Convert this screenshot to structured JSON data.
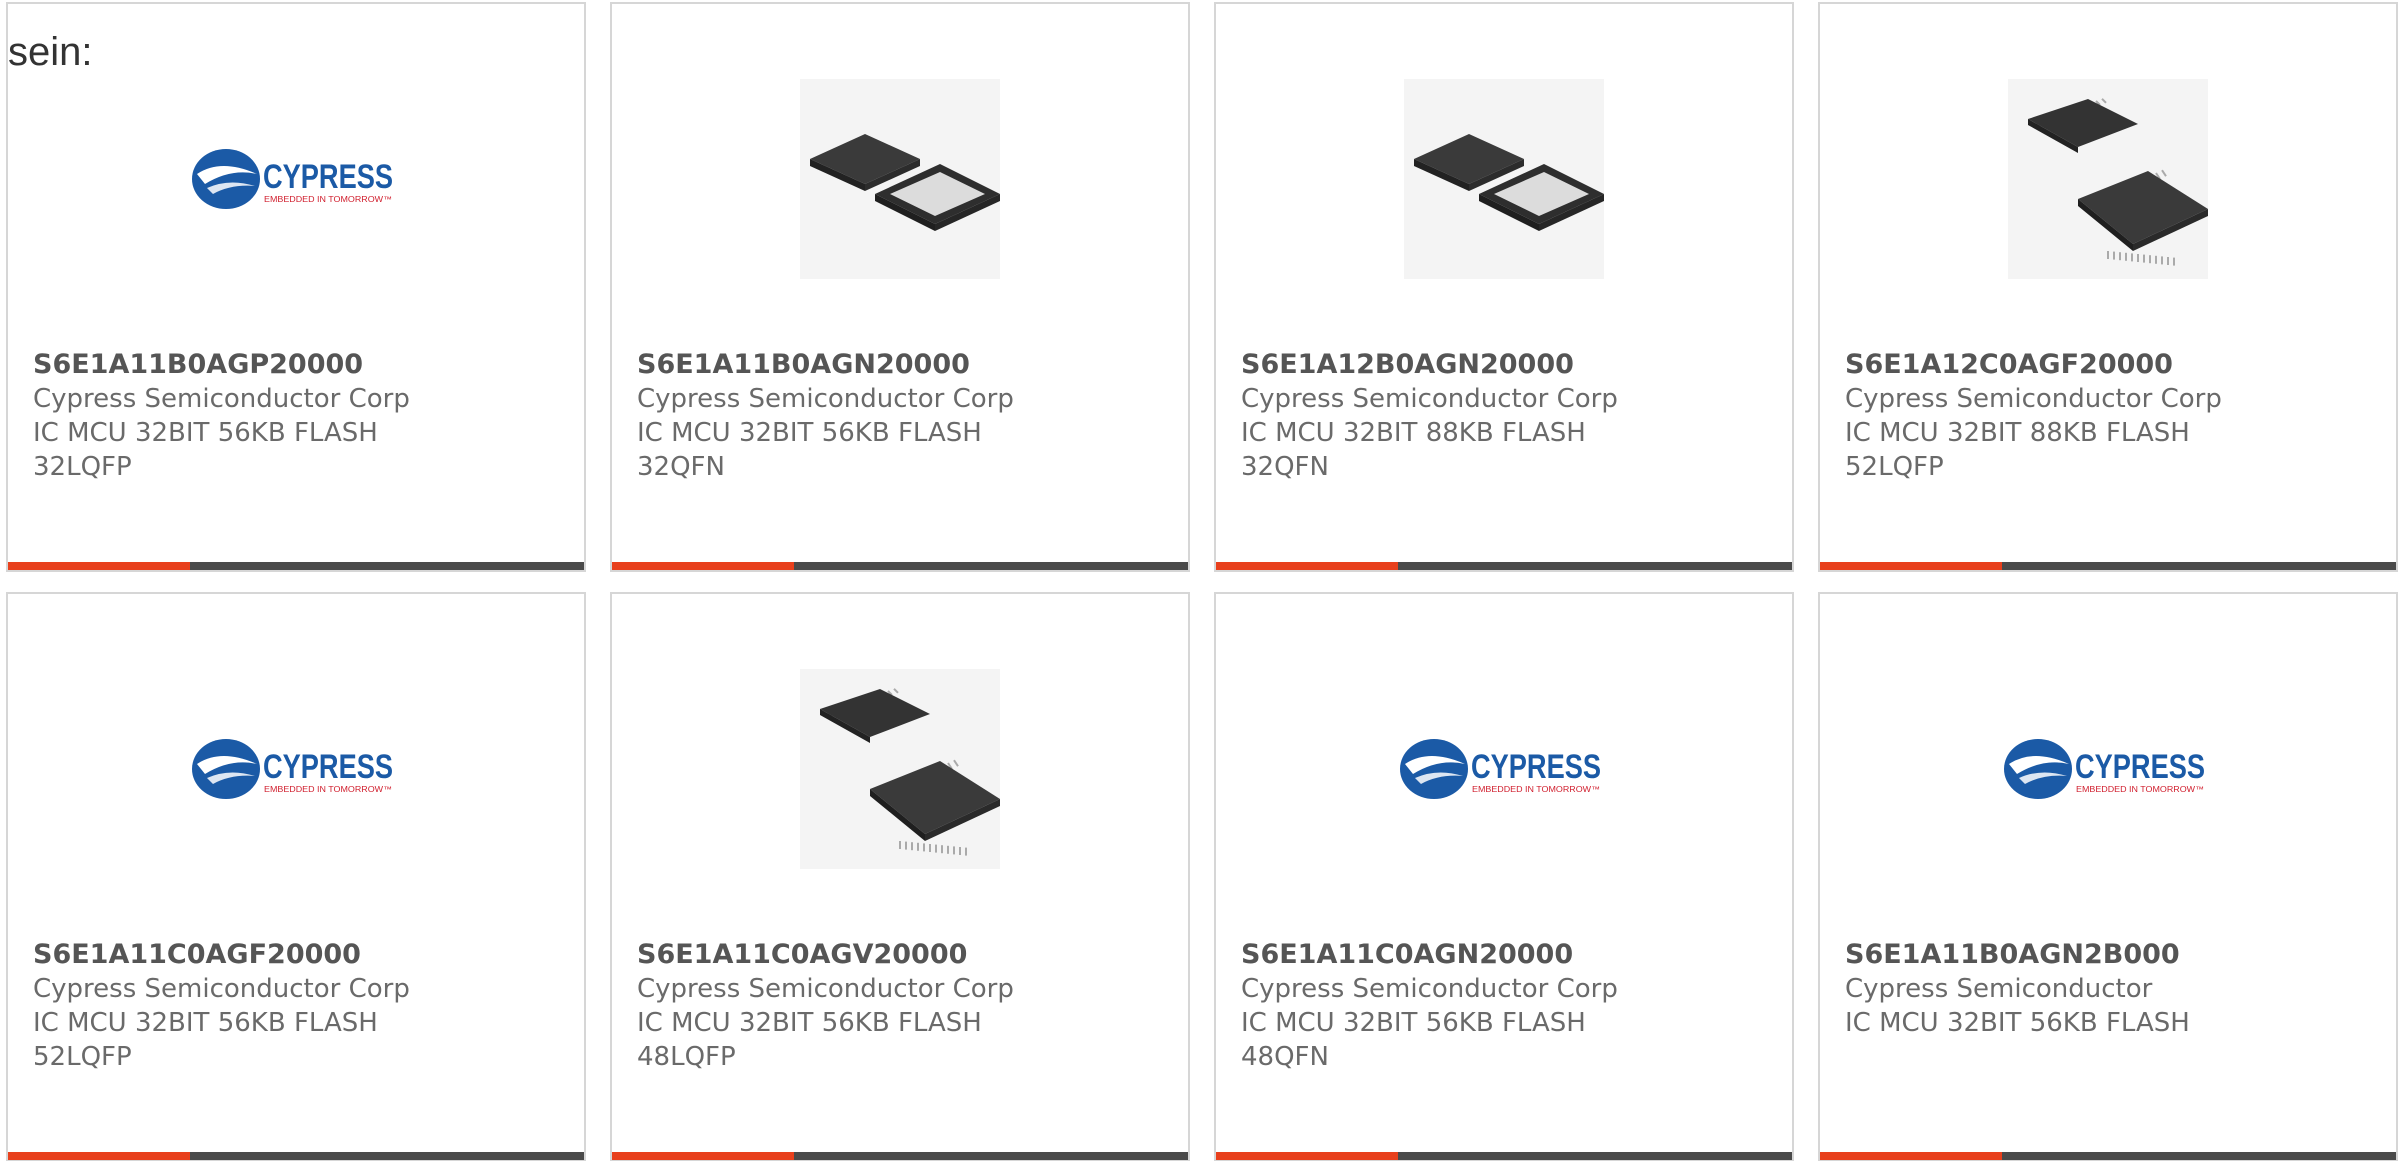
{
  "intro_text": "sein:",
  "colors": {
    "accent": "#e8401c",
    "bar": "#4a4a4a",
    "cypress_blue": "#1b5aa6",
    "cypress_red": "#d1202f"
  },
  "logo": {
    "brand": "CYPRESS",
    "tagline": "EMBEDDED IN TOMORROW™"
  },
  "products": [
    {
      "part": "S6E1A11B0AGP20000",
      "manufacturer": "Cypress Semiconductor Corp",
      "description": "IC MCU 32BIT 56KB FLASH",
      "package": "32LQFP",
      "image": "cypress-logo"
    },
    {
      "part": "S6E1A11B0AGN20000",
      "manufacturer": "Cypress Semiconductor Corp",
      "description": "IC MCU 32BIT 56KB FLASH",
      "package": "32QFN",
      "image": "qfn-chip-pair"
    },
    {
      "part": "S6E1A12B0AGN20000",
      "manufacturer": "Cypress Semiconductor Corp",
      "description": "IC MCU 32BIT 88KB FLASH",
      "package": "32QFN",
      "image": "qfn-chip-pair"
    },
    {
      "part": "S6E1A12C0AGF20000",
      "manufacturer": "Cypress Semiconductor Corp",
      "description": "IC MCU 32BIT 88KB FLASH",
      "package": "52LQFP",
      "image": "lqfp-chip-pair"
    },
    {
      "part": "S6E1A11C0AGF20000",
      "manufacturer": "Cypress Semiconductor Corp",
      "description": "IC MCU 32BIT 56KB FLASH",
      "package": "52LQFP",
      "image": "cypress-logo"
    },
    {
      "part": "S6E1A11C0AGV20000",
      "manufacturer": "Cypress Semiconductor Corp",
      "description": "IC MCU 32BIT 56KB FLASH",
      "package": "48LQFP",
      "image": "lqfp-chip-pair"
    },
    {
      "part": "S6E1A11C0AGN20000",
      "manufacturer": "Cypress Semiconductor Corp",
      "description": "IC MCU 32BIT 56KB FLASH",
      "package": "48QFN",
      "image": "cypress-logo"
    },
    {
      "part": "S6E1A11B0AGN2B000",
      "manufacturer": "Cypress Semiconductor",
      "description": "IC MCU 32BIT 56KB FLASH",
      "package": "",
      "image": "cypress-logo"
    }
  ]
}
